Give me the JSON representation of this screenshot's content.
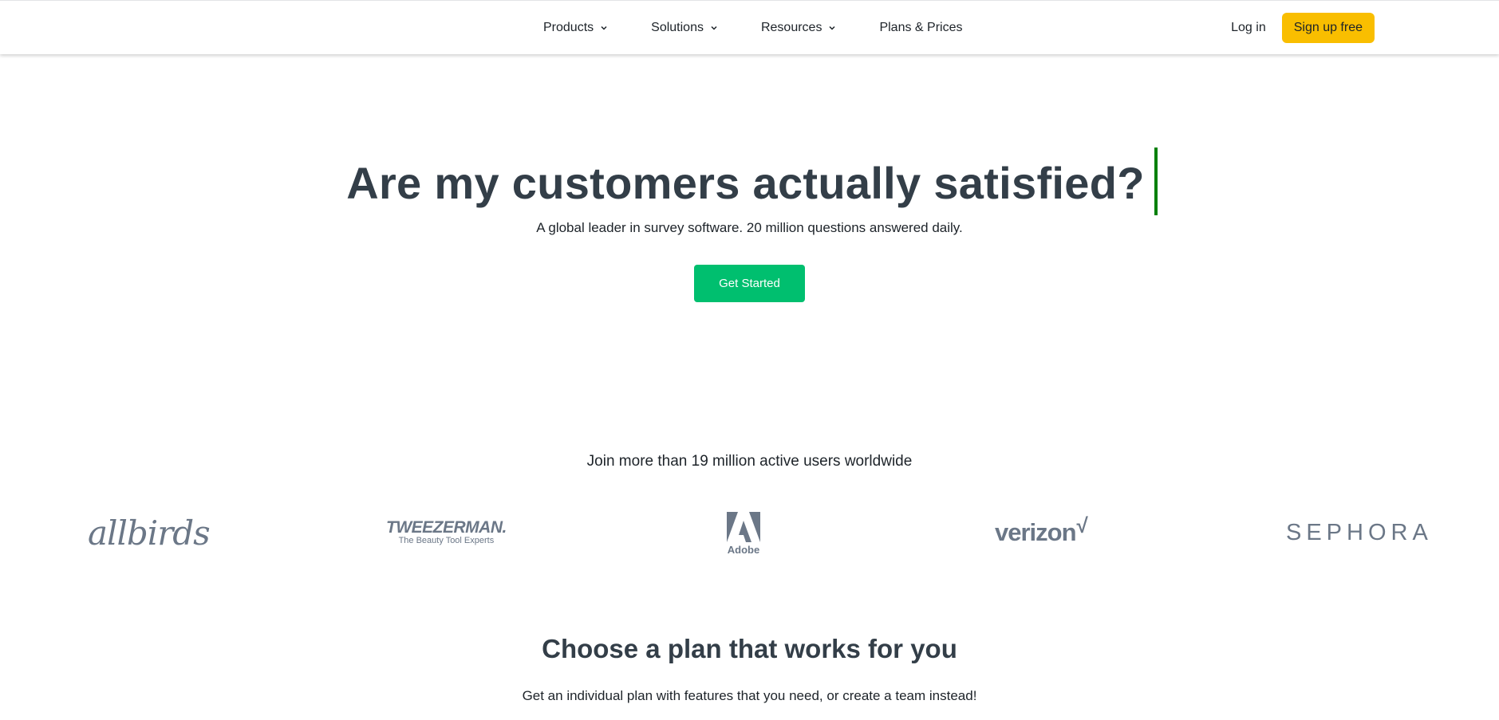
{
  "header": {
    "nav": [
      {
        "label": "Products",
        "has_dropdown": true
      },
      {
        "label": "Solutions",
        "has_dropdown": true
      },
      {
        "label": "Resources",
        "has_dropdown": true
      },
      {
        "label": "Plans & Prices",
        "has_dropdown": false
      }
    ],
    "login_label": "Log in",
    "signup_label": "Sign up free"
  },
  "hero": {
    "title": "Are my customers actually satisfied?",
    "subtitle": "A global leader in survey software. 20 million questions answered daily.",
    "cta_label": "Get Started"
  },
  "social_proof": {
    "heading": "Join more than 19 million active users worldwide",
    "logos": [
      {
        "name": "allbirds",
        "text": "allbirds"
      },
      {
        "name": "tweezerman",
        "text": "TWEEZERMAN.",
        "tagline": "The Beauty Tool Experts"
      },
      {
        "name": "adobe",
        "text": "Adobe"
      },
      {
        "name": "verizon",
        "text": "verizon",
        "mark": "√"
      },
      {
        "name": "sephora",
        "text": "SEPHORA"
      }
    ]
  },
  "plans": {
    "title": "Choose a plan that works for you",
    "subtitle": "Get an individual plan with features that you need, or create a team instead!"
  },
  "colors": {
    "signup_bg": "#f9be00",
    "cta_bg": "#00bf6f",
    "caret": "#00800a",
    "logo_gray": "#6b7787",
    "heading_text": "#333e48"
  },
  "icons": {
    "dropdown": "chevron-down-icon",
    "adobe_mark": "adobe-a-icon"
  }
}
